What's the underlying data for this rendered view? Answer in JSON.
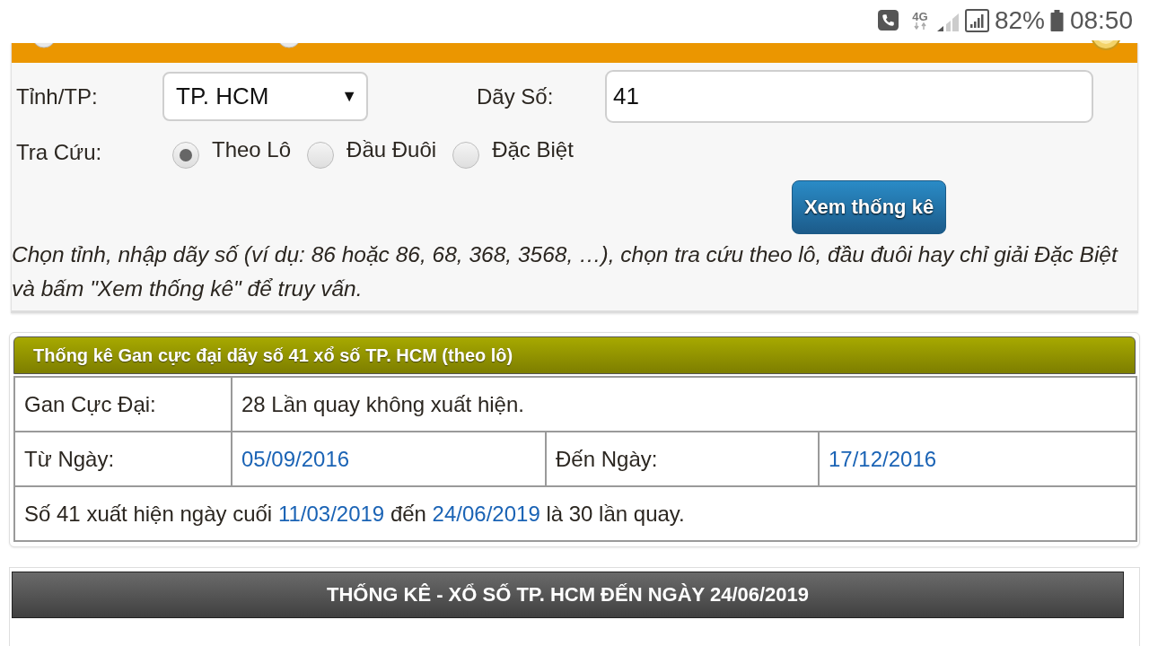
{
  "status_bar": {
    "network": "4G",
    "battery": "82%",
    "time": "08:50"
  },
  "search_form": {
    "province_label": "Tỉnh/TP:",
    "province_select": {
      "value": "TP. HCM",
      "caret": "▼"
    },
    "number_label": "Dãy Số:",
    "number_input": {
      "value": "41"
    },
    "lookup_label": "Tra Cứu:",
    "lookup_options": [
      {
        "label": "Theo Lô",
        "selected": true
      },
      {
        "label": "Đầu Đuôi",
        "selected": false
      },
      {
        "label": "Đặc Biệt",
        "selected": false
      }
    ],
    "submit_button": "Xem thống kê",
    "hint": "Chọn tỉnh, nhập dãy số (ví dụ: 86 hoặc 86, 68, 368, 3568, …), chọn tra cứu theo lô, đầu đuôi hay chỉ giải Đặc Biệt và bấm \"Xem thống kê\" để truy vấn."
  },
  "result": {
    "title": "Thống kê Gan cực đại dãy số 41 xổ số TP. HCM (theo lô)",
    "rows": [
      {
        "cells": [
          {
            "kind": "text",
            "text": "Gan Cực Đại:"
          },
          {
            "kind": "text",
            "text": "28 Lần quay không xuất hiện.",
            "colspan": 3
          }
        ]
      },
      {
        "cells": [
          {
            "kind": "text",
            "text": "Từ Ngày:"
          },
          {
            "kind": "link",
            "text": "05/09/2016"
          },
          {
            "kind": "text",
            "text": "Đến Ngày:"
          },
          {
            "kind": "link",
            "text": "17/12/2016"
          }
        ]
      },
      {
        "cells": [
          {
            "kind": "sentence",
            "colspan": 4,
            "parts": [
              {
                "kind": "text",
                "text": "Số 41 xuất hiện ngày cuối "
              },
              {
                "kind": "link",
                "text": "11/03/2019"
              },
              {
                "kind": "text",
                "text": " đến "
              },
              {
                "kind": "link",
                "text": "24/06/2019"
              },
              {
                "kind": "text",
                "text": " là 30 lần quay."
              }
            ]
          }
        ]
      }
    ]
  },
  "summary": {
    "title": "THỐNG KÊ - XỔ SỐ TP. HCM ĐẾN NGÀY 24/06/2019"
  }
}
